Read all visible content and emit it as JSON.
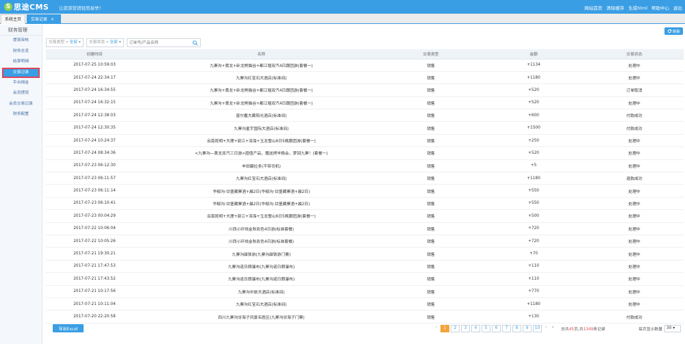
{
  "app": {
    "logo_mark": "S",
    "logo_text": "思途CMS",
    "slogan": "让旅游营销轻而易举！"
  },
  "topnav": [
    "网站首页",
    "清除缓存",
    "生成html",
    "帮助中心",
    "退出"
  ],
  "tabs": {
    "home": "系统主页",
    "active": "交易记录",
    "close": "×"
  },
  "sidebar": {
    "title": "财务管理",
    "items": [
      "提现审核",
      "财务总览",
      "结算明细",
      "交易记录",
      "平台佣金",
      "会员提现",
      "会员交易记录",
      "财务配置"
    ],
    "active_index": 3
  },
  "toolbar": {
    "refresh_label": "刷新"
  },
  "filters": {
    "type_label": "交易类型",
    "type_value": "全部",
    "status_label": "交易状态",
    "status_value": "全部",
    "search_placeholder": "订单号/产品名称"
  },
  "table": {
    "headers": [
      "创建时间",
      "名称",
      "交易类型",
      "金额",
      "交易状态"
    ],
    "rows": [
      [
        "2017-07-25 10:59:03",
        "九寨沟+黄龙+卧龙熊猫谷+都江堰双汽4日跟团游(套餐一)",
        "销售",
        "+1134",
        "处理中"
      ],
      [
        "2017-07-24 22:34:17",
        "九寨沟红宝石大酒店(标准间)",
        "销售",
        "+1180",
        "处理中"
      ],
      [
        "2017-07-24 16:34:55",
        "九寨沟+黄龙+卧龙熊猫谷+都江堰双汽4日跟团游(套餐一)",
        "销售",
        "+520",
        "订单取消"
      ],
      [
        "2017-07-24 16:32:15",
        "九寨沟+黄龙+卧龙熊猫谷+都江堰双汽4日跟团游(套餐一)",
        "销售",
        "+520",
        "处理中"
      ],
      [
        "2017-07-24 12:38:03",
        "普尔嘉大藏阳光酒店(标准间)",
        "销售",
        "+600",
        "付款成功"
      ],
      [
        "2017-07-24 12:30:35",
        "九寨沟星宇国际大酒店(标准间)",
        "销售",
        "+1500",
        "付款成功"
      ],
      [
        "2017-07-24 10:24:37",
        "云南昆明+大理+丽江+洱海+玉龙雪山6日5晚跟团游(套餐一)",
        "销售",
        "+250",
        "处理中"
      ],
      [
        "2017-07-24 08:34:36",
        "<九寨沟—黄龙双汽三日游>超值产品，赠送烤羊晚会，梦回九寨！(套餐一)",
        "销售",
        "+520",
        "处理中"
      ],
      [
        "2017-07-23 06:12:30",
        "丰田霸拉多(不带司机)",
        "销售",
        "+5",
        "处理中"
      ],
      [
        "2017-07-23 06:11:57",
        "九寨沟红宝石大酒店(标准间)",
        "销售",
        "+1180",
        "退款成功"
      ],
      [
        "2017-07-23 06:11:14",
        "华榈沟-甘堡藏寨酒+晨2日(华榈沟-甘堡藏寨酒+晨2日)",
        "销售",
        "+550",
        "处理中"
      ],
      [
        "2017-07-23 06:10:41",
        "华榈沟-甘堡藏寨酒+晨2日(华榈沟-甘堡藏寨酒+晨2日)",
        "销售",
        "+550",
        "处理中"
      ],
      [
        "2017-07-23 00:04:29",
        "云南昆明+大理+丽江+洱海+玉龙雪山6日5晚跟团游(套餐一)",
        "销售",
        "+500",
        "处理中"
      ],
      [
        "2017-07-22 10:06:04",
        "川西小环线金秋彩色4日游(标准套餐)",
        "销售",
        "+720",
        "处理中"
      ],
      [
        "2017-07-22 10:05:26",
        "川西小环线金秋彩色4日游(标准套餐)",
        "销售",
        "+720",
        "处理中"
      ],
      [
        "2017-07-21 19:30:21",
        "九寨沟甜铁游(九寨沟甜铁游门票)",
        "销售",
        "+70",
        "处理中"
      ],
      [
        "2017-07-21 17:47:53",
        "九寨沟诺日朗瀑布(九寨沟诺日朗瀑布)",
        "销售",
        "+110",
        "处理中"
      ],
      [
        "2017-07-21 17:43:52",
        "九寨沟诺日朗瀑布(九寨沟诺日朗瀑布)",
        "销售",
        "+110",
        "处理中"
      ],
      [
        "2017-07-21 10:17:56",
        "九寨沟中旅大酒店(标准间)",
        "销售",
        "+770",
        "处理中"
      ],
      [
        "2017-07-21 10:11:04",
        "九寨沟红宝石大酒店(标准间)",
        "销售",
        "+1180",
        "处理中"
      ],
      [
        "2017-07-20 22:20:58",
        "四川九寨沟甘海子风景名胜区(九寨沟甘海子门票)",
        "销售",
        "+130",
        "付款成功"
      ]
    ]
  },
  "footer": {
    "export_label": "导出Excel",
    "pages": [
      "1",
      "2",
      "3",
      "4",
      "5",
      "6",
      "7",
      "8",
      "9",
      "10"
    ],
    "current_page": "1",
    "prev": "‹",
    "next": "›",
    "last": "»",
    "total_prefix": "总共",
    "total_pages": "45",
    "total_mid": "页,共",
    "total_records": "1349",
    "total_suffix": "条记录",
    "perpage_label": "每页显示数量",
    "perpage_value": "30"
  },
  "colors": {
    "primary": "#3a9ee4",
    "active_page": "#f3a43c",
    "highlight": "#e84a4a"
  }
}
